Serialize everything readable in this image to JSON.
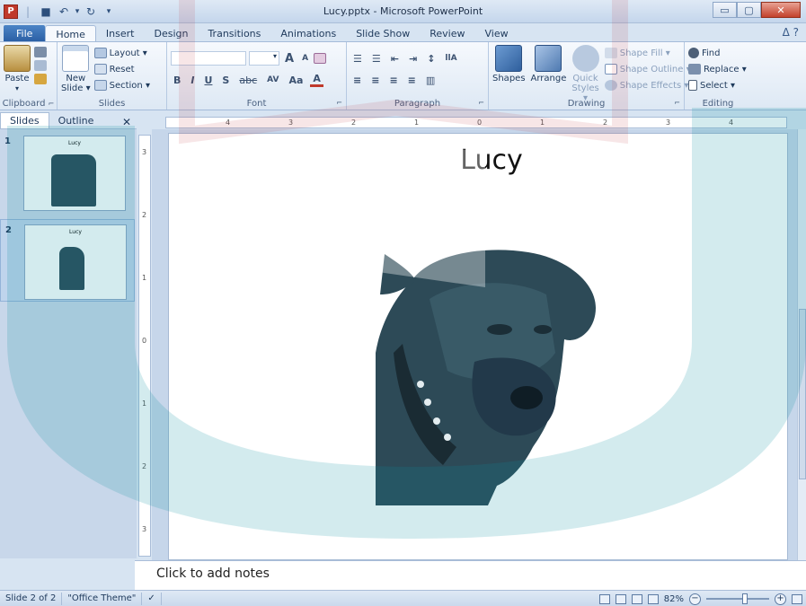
{
  "window": {
    "title": "Lucy.pptx - Microsoft PowerPoint",
    "app_icon_letter": "P",
    "minimize_glyph": "▭",
    "maximize_glyph": "▢",
    "close_glyph": "✕"
  },
  "quick_access": {
    "save_glyph": "■",
    "undo_glyph": "↶",
    "undo_arrow": "▾",
    "repeat_glyph": "↻",
    "customize_glyph": "▾",
    "separator": "|"
  },
  "ribbon_tabs": [
    {
      "label": "File"
    },
    {
      "label": "Home"
    },
    {
      "label": "Insert"
    },
    {
      "label": "Design"
    },
    {
      "label": "Transitions"
    },
    {
      "label": "Animations"
    },
    {
      "label": "Slide Show"
    },
    {
      "label": "Review"
    },
    {
      "label": "View"
    }
  ],
  "help_glyph": "ᐃ ?",
  "ribbon": {
    "clipboard": {
      "group_label": "Clipboard",
      "paste": "Paste",
      "paste_arrow": "▾",
      "launcher": "⌐"
    },
    "slides": {
      "group_label": "Slides",
      "new_slide": "New",
      "new_slide2": "Slide ▾",
      "layout": "Layout ▾",
      "reset": "Reset",
      "section": "Section ▾"
    },
    "font": {
      "group_label": "Font",
      "grow": "A",
      "shrink": "A",
      "bold": "B",
      "italic": "I",
      "underline": "U",
      "shadow": "S",
      "strike": "abc",
      "spacing": "AV",
      "case": "Aa",
      "color": "A",
      "launcher": "⌐",
      "size_arrow": "▾"
    },
    "paragraph": {
      "group_label": "Paragraph",
      "bullets": "☰",
      "numbering": "☰",
      "decrease_indent": "⇤",
      "increase_indent": "⇥",
      "line_spacing": "↕",
      "align_left": "≡",
      "align_center": "≡",
      "align_right": "≡",
      "justify": "≡",
      "columns": "▥",
      "direction": "llA",
      "launcher": "⌐"
    },
    "drawing": {
      "group_label": "Drawing",
      "shapes": "Shapes",
      "arrange": "Arrange",
      "quick_styles": "Quick",
      "quick_styles2": "Styles ▾",
      "shape_fill": "Shape Fill ▾",
      "shape_outline": "Shape Outline ▾",
      "shape_effects": "Shape Effects ▾",
      "launcher": "⌐"
    },
    "editing": {
      "group_label": "Editing",
      "find": "Find",
      "replace": "Replace ▾",
      "select": "Select ▾"
    }
  },
  "pane": {
    "tab_slides": "Slides",
    "tab_outline": "Outline",
    "close_glyph": "✕",
    "thumbnails": [
      {
        "number": "1",
        "title": "Lucy"
      },
      {
        "number": "2",
        "title": "Lucy"
      }
    ]
  },
  "hruler_labels": [
    "4",
    "3",
    "2",
    "1",
    "0",
    "1",
    "2",
    "3",
    "4"
  ],
  "vruler_labels": [
    "3",
    "2",
    "1",
    "0",
    "1",
    "2",
    "3"
  ],
  "slide": {
    "title": "Lucy"
  },
  "notes": {
    "placeholder": "Click to add notes"
  },
  "status": {
    "slide_info": "Slide 2 of 2",
    "theme": "\"Office Theme\"",
    "spell_glyph": "✓",
    "zoom": "82%",
    "zoom_out": "−",
    "zoom_in": "+"
  },
  "colors": {
    "accent": "#2a5ea3",
    "photo_tint": "#2d4a57",
    "watermark": "#0d8fa3"
  }
}
